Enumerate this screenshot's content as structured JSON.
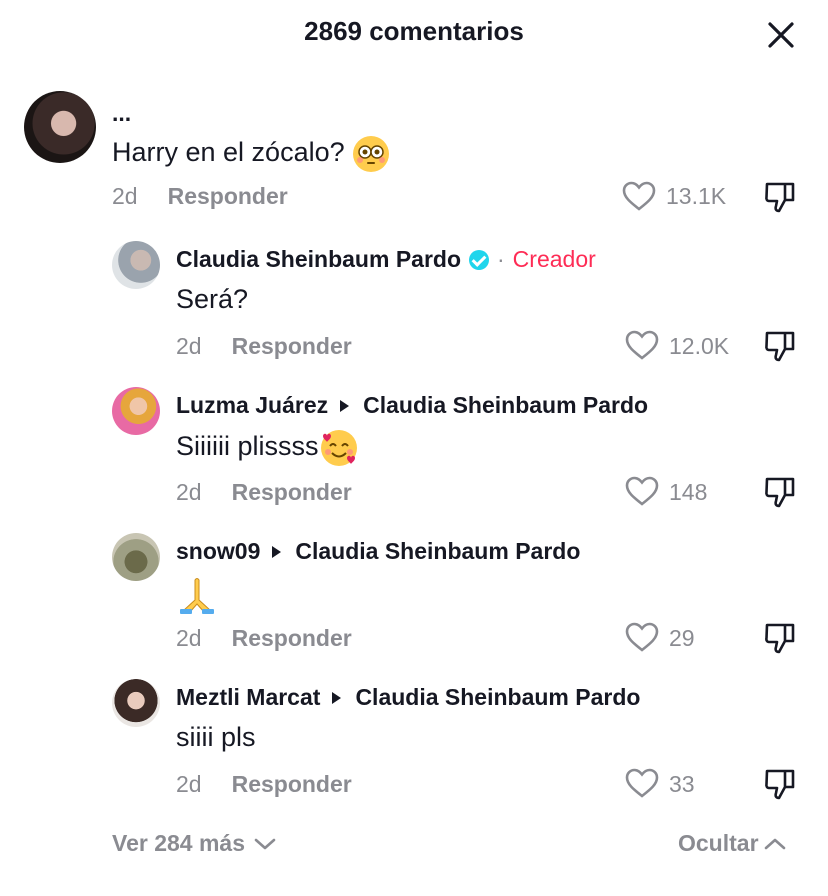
{
  "header": {
    "title": "2869 comentarios"
  },
  "comments": [
    {
      "username": "...",
      "text": "Harry en el zócalo?",
      "emoji": "😳",
      "time": "2d",
      "reply": "Responder",
      "likes": "13.1K"
    },
    {
      "username": "Claudia Sheinbaum Pardo",
      "badge": "·",
      "role": "Creador",
      "text": "Será?",
      "time": "2d",
      "reply": "Responder",
      "likes": "12.0K"
    },
    {
      "username": "Luzma Juárez",
      "reply_to": "Claudia Sheinbaum Pardo",
      "text": "Siiiiii plissss",
      "emoji": "🥰",
      "time": "2d",
      "reply": "Responder",
      "likes": "148"
    },
    {
      "username": "snow09",
      "reply_to": "Claudia Sheinbaum Pardo",
      "text": "🙏",
      "time": "2d",
      "reply": "Responder",
      "likes": "29"
    },
    {
      "username": "Meztli Marcat",
      "reply_to": "Claudia Sheinbaum Pardo",
      "text": "siiii pls",
      "time": "2d",
      "reply": "Responder",
      "likes": "33"
    }
  ],
  "footer": {
    "more": "Ver 284 más",
    "hide": "Ocultar"
  },
  "colors": {
    "accent": "#fe2c55",
    "verified": "#20d5ec",
    "muted": "#8a8b91"
  }
}
